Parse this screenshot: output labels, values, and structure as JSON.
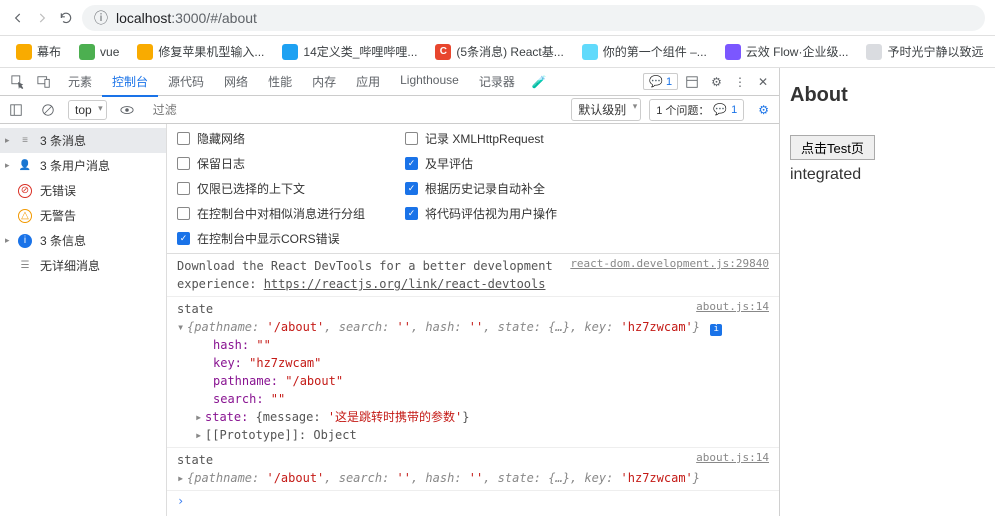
{
  "browser": {
    "url_info_label": "ⓘ",
    "url_host": "localhost",
    "url_port_path": ":3000/#/about"
  },
  "bookmarks": [
    {
      "label": "幕布",
      "color": "bm-yellow"
    },
    {
      "label": "vue",
      "color": "bm-green"
    },
    {
      "label": "修复苹果机型输入...",
      "color": "bm-yellow"
    },
    {
      "label": "14定义类_哔哩哔哩...",
      "color": "bm-blue"
    },
    {
      "label": "(5条消息) React基...",
      "color": "bm-red",
      "badge": "C"
    },
    {
      "label": "你的第一个组件 –...",
      "color": "bm-cyan"
    },
    {
      "label": "云效 Flow·企业级...",
      "color": "bm-purple"
    },
    {
      "label": "予时光宁静以致远",
      "color": "bm-gray"
    }
  ],
  "devtools": {
    "tabs": [
      "元素",
      "控制台",
      "源代码",
      "网络",
      "性能",
      "内存",
      "应用",
      "Lighthouse",
      "记录器"
    ],
    "active_tab": 1,
    "badge_count": "1",
    "ctx": "top",
    "filter_placeholder": "过滤",
    "level_label": "默认级别",
    "issue_label": "1 个问题：",
    "issue_count": "1"
  },
  "sidebar": [
    {
      "label": "3 条消息",
      "icon": "list",
      "sel": true,
      "exp": true
    },
    {
      "label": "3 条用户消息",
      "icon": "user",
      "exp": true
    },
    {
      "label": "无错误",
      "icon": "err",
      "exp": false
    },
    {
      "label": "无警告",
      "icon": "warn",
      "exp": false
    },
    {
      "label": "3 条信息",
      "icon": "info",
      "exp": true
    },
    {
      "label": "无详细消息",
      "icon": "bars",
      "exp": false
    }
  ],
  "settings": {
    "left": [
      {
        "label": "隐藏网络",
        "on": false
      },
      {
        "label": "保留日志",
        "on": false
      },
      {
        "label": "仅限已选择的上下文",
        "on": false
      },
      {
        "label": "在控制台中对相似消息进行分组",
        "on": false
      },
      {
        "label": "在控制台中显示CORS错误",
        "on": true
      }
    ],
    "right": [
      {
        "label": "记录 XMLHttpRequest",
        "on": false
      },
      {
        "label": "及早评估",
        "on": true
      },
      {
        "label": "根据历史记录自动补全",
        "on": true
      },
      {
        "label": "将代码评估视为用户操作",
        "on": true
      }
    ]
  },
  "log": {
    "msg1_src": "react-dom.development.js:29840",
    "msg1_a": "Download the React DevTools for a better development experience: ",
    "msg1_link": "https://reactjs.org/link/react-devtools",
    "state_label": "state",
    "state_src": "about.js:14",
    "obj_summary_open": "{pathname: ",
    "obj_path": "'/about'",
    "obj_mid1": ", search: ",
    "obj_empty": "''",
    "obj_mid2": ", hash: ",
    "obj_mid3": ", state: ",
    "obj_braces": "{…}",
    "obj_mid4": ", key: ",
    "obj_key": "'hz7zwcam'",
    "obj_close": "}",
    "fields": {
      "hash_k": "hash: ",
      "hash_v": "\"\"",
      "key_k": "key: ",
      "key_v": "\"hz7zwcam\"",
      "path_k": "pathname: ",
      "path_v": "\"/about\"",
      "search_k": "search: ",
      "search_v": "\"\"",
      "state_k": "state: ",
      "state_v_pre": "{message: ",
      "state_v_msg": "'这是跳转时携带的参数'",
      "state_v_post": "}",
      "proto_k": "[[Prototype]]: ",
      "proto_v": "Object"
    }
  },
  "page": {
    "title": "About",
    "button": "点击Test页",
    "text": "integrated"
  }
}
